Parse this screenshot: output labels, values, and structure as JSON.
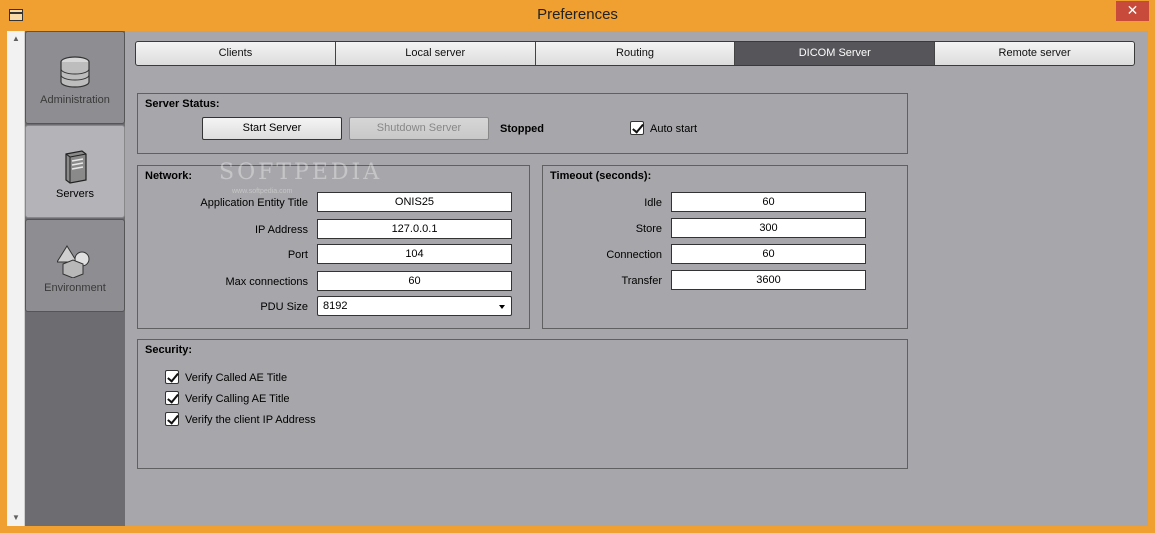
{
  "window": {
    "title": "Preferences",
    "close": "✕"
  },
  "sidebar": {
    "items": [
      {
        "label": "Administration",
        "icon": "database-icon",
        "active": false
      },
      {
        "label": "Servers",
        "icon": "server-icon",
        "active": true
      },
      {
        "label": "Environment",
        "icon": "shapes-icon",
        "active": false
      }
    ]
  },
  "tabs": [
    {
      "label": "Clients",
      "active": false
    },
    {
      "label": "Local server",
      "active": false
    },
    {
      "label": "Routing",
      "active": false
    },
    {
      "label": "DICOM Server",
      "active": true
    },
    {
      "label": "Remote server",
      "active": false
    }
  ],
  "server_status": {
    "title": "Server Status:",
    "start_label": "Start Server",
    "shutdown_label": "Shutdown Server",
    "state": "Stopped",
    "auto_start_label": "Auto start",
    "auto_start_checked": true
  },
  "network": {
    "title": "Network:",
    "ae_title_label": "Application Entity Title",
    "ae_title_value": "ONIS25",
    "ip_label": "IP Address",
    "ip_value": "127.0.0.1",
    "port_label": "Port",
    "port_value": "104",
    "max_conn_label": "Max connections",
    "max_conn_value": "60",
    "pdu_label": "PDU Size",
    "pdu_value": "8192"
  },
  "timeout": {
    "title": "Timeout (seconds):",
    "idle_label": "Idle",
    "idle_value": "60",
    "store_label": "Store",
    "store_value": "300",
    "connection_label": "Connection",
    "connection_value": "60",
    "transfer_label": "Transfer",
    "transfer_value": "3600"
  },
  "security": {
    "title": "Security:",
    "verify_called_label": "Verify Called AE Title",
    "verify_calling_label": "Verify Calling AE Title",
    "verify_ip_label": "Verify the client IP Address"
  },
  "watermark": {
    "text": "SOFTPEDIA",
    "sub": "www.softpedia.com"
  }
}
